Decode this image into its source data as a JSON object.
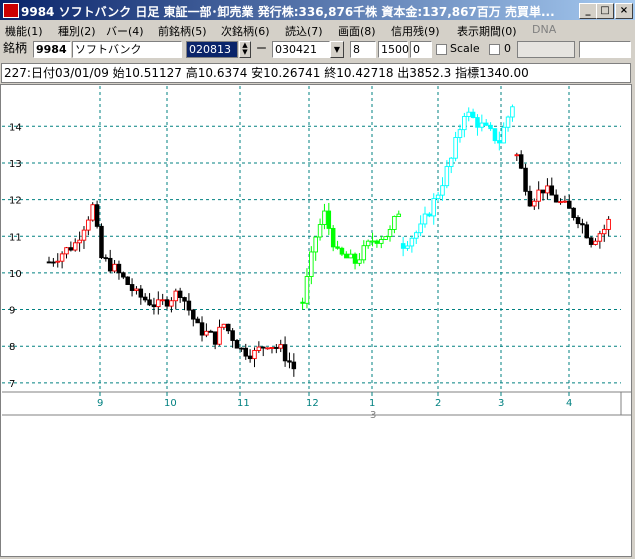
{
  "window": {
    "title": "9984 ソフトバンク 日足 東証一部･卸売業 発行株:336,876千株 資本金:137,867百万 売買単...",
    "minimize_label": "_",
    "maximize_label": "□",
    "close_label": "×"
  },
  "menu": {
    "items": [
      "機能(1)",
      "種別(2)",
      "バー(4)",
      "前銘柄(5)",
      "次銘柄(6)",
      "読込(7)",
      "画面(8)",
      "信用残(9)",
      "表示期間(0)"
    ],
    "disabled_item": "DNA"
  },
  "toolbar": {
    "stock_label": "銘柄",
    "code": "9984",
    "name": "ソフトバンク",
    "start_date": "020813",
    "dash": "ー",
    "end_date": "030421",
    "bars_value": "8",
    "width_value": "1500",
    "offset_value": "0",
    "scale_label": "Scale",
    "scale_value": "0"
  },
  "info": {
    "text": "227:日付03/01/09 始10.51127 高10.6374 安10.26741 終10.42718 出3852.3 指標1340.00"
  },
  "colors": {
    "period_1": "#000000",
    "period_2": "#00ff00",
    "period_3": "#00ffff",
    "period_4": "#000000",
    "up_candle_outline": "#ff0000",
    "gridline": "#008080"
  },
  "chart_data": {
    "type": "candlestick",
    "y_ticks": [
      7,
      8,
      9,
      10,
      11,
      12,
      13,
      14
    ],
    "ylim": [
      6.75,
      15.1
    ],
    "x_ticks": [
      "9",
      "10",
      "11",
      "12",
      "1",
      "2",
      "3",
      "4"
    ],
    "x_sub_label": "3",
    "grid": true,
    "segments": [
      {
        "color": "#000000",
        "points": [
          [
            0,
            10.3
          ],
          [
            6,
            10.8
          ],
          [
            10,
            11.8
          ],
          [
            12,
            10.4
          ],
          [
            15,
            10.1
          ],
          [
            18,
            9.7
          ],
          [
            20,
            9.4
          ],
          [
            25,
            9.1
          ],
          [
            30,
            9.5
          ],
          [
            34,
            8.5
          ],
          [
            38,
            8.2
          ],
          [
            40,
            8.6
          ],
          [
            44,
            7.9
          ],
          [
            47,
            7.8
          ],
          [
            50,
            8.1
          ],
          [
            53,
            7.9
          ],
          [
            56,
            7.4
          ]
        ]
      },
      {
        "color": "#00ff00",
        "points": [
          [
            58,
            9.2
          ],
          [
            61,
            11.0
          ],
          [
            63,
            11.6
          ],
          [
            66,
            10.5
          ],
          [
            70,
            10.3
          ],
          [
            74,
            10.9
          ],
          [
            78,
            11.1
          ],
          [
            80,
            11.7
          ]
        ]
      },
      {
        "color": "#00ffff",
        "points": [
          [
            81,
            10.8
          ],
          [
            85,
            11.2
          ],
          [
            89,
            12.2
          ],
          [
            92,
            13.1
          ],
          [
            95,
            14.4
          ],
          [
            99,
            14.0
          ],
          [
            103,
            13.6
          ],
          [
            106,
            14.6
          ]
        ]
      },
      {
        "color": "#000000",
        "points": [
          [
            107,
            13.2
          ],
          [
            110,
            12.0
          ],
          [
            113,
            12.3
          ],
          [
            117,
            11.9
          ],
          [
            121,
            11.5
          ],
          [
            124,
            10.9
          ],
          [
            127,
            11.2
          ],
          [
            128,
            11.4
          ]
        ]
      }
    ],
    "total_bars": 130
  }
}
